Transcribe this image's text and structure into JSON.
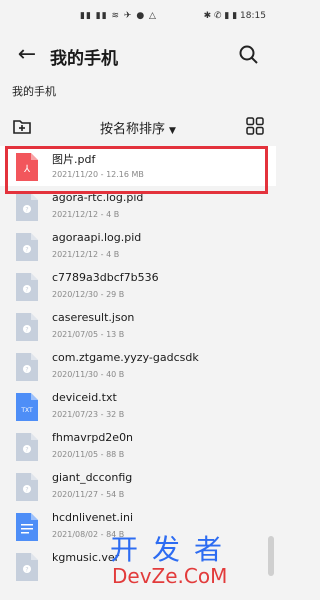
{
  "status": {
    "left_text": "▮▮ ▮▮ ≋ ✈ ● △",
    "right_text": "✱ ✆ ▮ ▮ 18:15"
  },
  "header": {
    "title": "我的手机"
  },
  "breadcrumb": "我的手机",
  "toolbar": {
    "sort_label": "按名称排序"
  },
  "files": [
    {
      "name": "图片.pdf",
      "meta": "2021/11/20 - 12.16 MB",
      "type": "pdf",
      "selected": true
    },
    {
      "name": "agora-rtc.log.pid",
      "meta": "2021/12/12 - 4 B",
      "type": "unknown"
    },
    {
      "name": "agoraapi.log.pid",
      "meta": "2021/12/12 - 4 B",
      "type": "unknown"
    },
    {
      "name": "c7789a3dbcf7b536",
      "meta": "2020/12/30 - 29 B",
      "type": "unknown"
    },
    {
      "name": "caseresult.json",
      "meta": "2021/07/05 - 13 B",
      "type": "unknown"
    },
    {
      "name": "com.ztgame.yyzy-gadcsdk",
      "meta": "2020/11/30 - 40 B",
      "type": "unknown"
    },
    {
      "name": "deviceid.txt",
      "meta": "2021/07/23 - 32 B",
      "type": "txt"
    },
    {
      "name": "fhmavrpd2e0n",
      "meta": "2020/11/05 - 88 B",
      "type": "unknown"
    },
    {
      "name": "giant_dcconfig",
      "meta": "2020/11/27 - 54 B",
      "type": "unknown"
    },
    {
      "name": "hcdnlivenet.ini",
      "meta": "2021/08/02 - 84 B",
      "type": "doc"
    },
    {
      "name": "kgmusic.ver",
      "meta": "",
      "type": "unknown"
    }
  ],
  "watermark": {
    "cn": "开发者",
    "en": "DevZe.CoM"
  },
  "colors": {
    "selection_border": "#e3323c",
    "pdf_icon": "#f2565c",
    "txt_icon": "#4e8ef7",
    "generic_icon": "#c6cfdc",
    "doc_icon": "#4e8ef7"
  }
}
